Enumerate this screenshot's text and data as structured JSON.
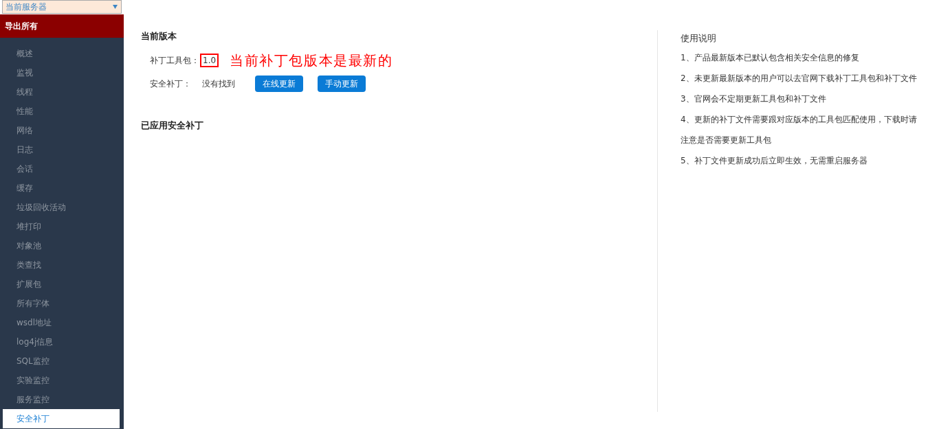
{
  "server_select": {
    "value": "当前服务器"
  },
  "export_button": {
    "label": "导出所有"
  },
  "sidebar": {
    "items": [
      {
        "label": "概述",
        "selected": false
      },
      {
        "label": "监视",
        "selected": false
      },
      {
        "label": "线程",
        "selected": false
      },
      {
        "label": "性能",
        "selected": false
      },
      {
        "label": "网络",
        "selected": false
      },
      {
        "label": "日志",
        "selected": false
      },
      {
        "label": "会话",
        "selected": false
      },
      {
        "label": "缓存",
        "selected": false
      },
      {
        "label": "垃圾回收活动",
        "selected": false
      },
      {
        "label": "堆打印",
        "selected": false
      },
      {
        "label": "对象池",
        "selected": false
      },
      {
        "label": "类查找",
        "selected": false
      },
      {
        "label": "扩展包",
        "selected": false
      },
      {
        "label": "所有字体",
        "selected": false
      },
      {
        "label": "wsdl地址",
        "selected": false
      },
      {
        "label": "log4j信息",
        "selected": false
      },
      {
        "label": "SQL监控",
        "selected": false
      },
      {
        "label": "实验监控",
        "selected": false
      },
      {
        "label": "服务监控",
        "selected": false
      },
      {
        "label": "安全补丁",
        "selected": true
      }
    ]
  },
  "current_version": {
    "title": "当前版本",
    "toolkit_label": "补丁工具包：",
    "toolkit_version": "1.0",
    "version_note": "当前补丁包版本是最新的",
    "patch_label": "安全补丁：",
    "patch_status": "没有找到",
    "buttons": [
      "在线更新",
      "手动更新"
    ]
  },
  "applied_patches": {
    "title": "已应用安全补丁"
  },
  "instructions": {
    "title": "使用说明",
    "items": [
      "1、产品最新版本已默认包含相关安全信息的修复",
      "2、未更新最新版本的用户可以去官网下载补丁工具包和补丁文件",
      "3、官网会不定期更新工具包和补丁文件",
      "4、更新的补丁文件需要跟对应版本的工具包匹配使用，下载时请注意是否需要更新工具包",
      "5、补丁文件更新成功后立即生效，无需重启服务器"
    ]
  }
}
